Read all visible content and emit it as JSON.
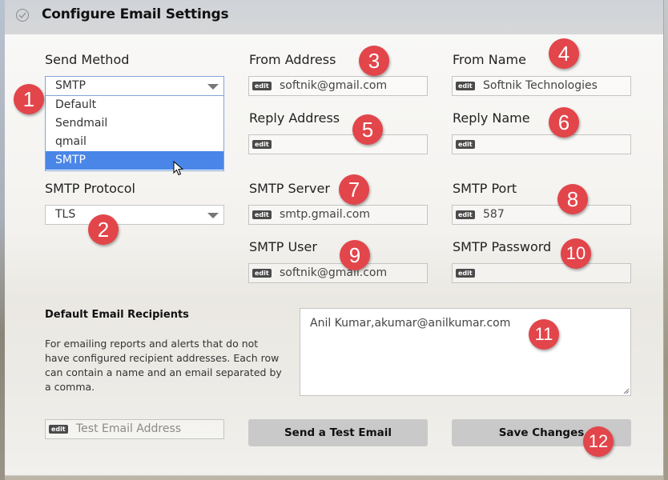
{
  "header": {
    "title": "Configure Email Settings",
    "icon": "check-circle-icon"
  },
  "send_method": {
    "label": "Send Method",
    "selected": "SMTP",
    "options": [
      "Default",
      "Sendmail",
      "qmail",
      "SMTP"
    ],
    "highlighted_option": "SMTP"
  },
  "smtp_protocol": {
    "label": "SMTP Protocol",
    "selected": "TLS"
  },
  "from_address": {
    "label": "From Address",
    "badge": "edit",
    "value": "softnik@gmail.com"
  },
  "from_name": {
    "label": "From Name",
    "badge": "edit",
    "value": "Softnik Technologies"
  },
  "reply_address": {
    "label": "Reply Address",
    "badge": "edit",
    "value": ""
  },
  "reply_name": {
    "label": "Reply Name",
    "badge": "edit",
    "value": ""
  },
  "smtp_server": {
    "label": "SMTP Server",
    "badge": "edit",
    "value": "smtp.gmail.com"
  },
  "smtp_port": {
    "label": "SMTP Port",
    "badge": "edit",
    "value": "587"
  },
  "smtp_user": {
    "label": "SMTP User",
    "badge": "edit",
    "value": "softnik@gmail.com"
  },
  "smtp_password": {
    "label": "SMTP Password",
    "badge": "edit",
    "value": ""
  },
  "recipients": {
    "title": "Default Email Recipients",
    "description": "For emailing reports and alerts that do not have configured recipient addresses. Each row can contain a name and an email separated by a comma.",
    "value": "Anil Kumar,akumar@anilkumar.com"
  },
  "test_email": {
    "badge": "edit",
    "placeholder": "Test Email Address",
    "send_button": "Send a Test Email"
  },
  "save_button": "Save Changes",
  "markers": [
    "1",
    "2",
    "3",
    "4",
    "5",
    "6",
    "7",
    "8",
    "9",
    "10",
    "11",
    "12"
  ],
  "colors": {
    "marker": "#e2454a",
    "selected_option": "#4a86e8",
    "button": "#c9c9c9"
  }
}
